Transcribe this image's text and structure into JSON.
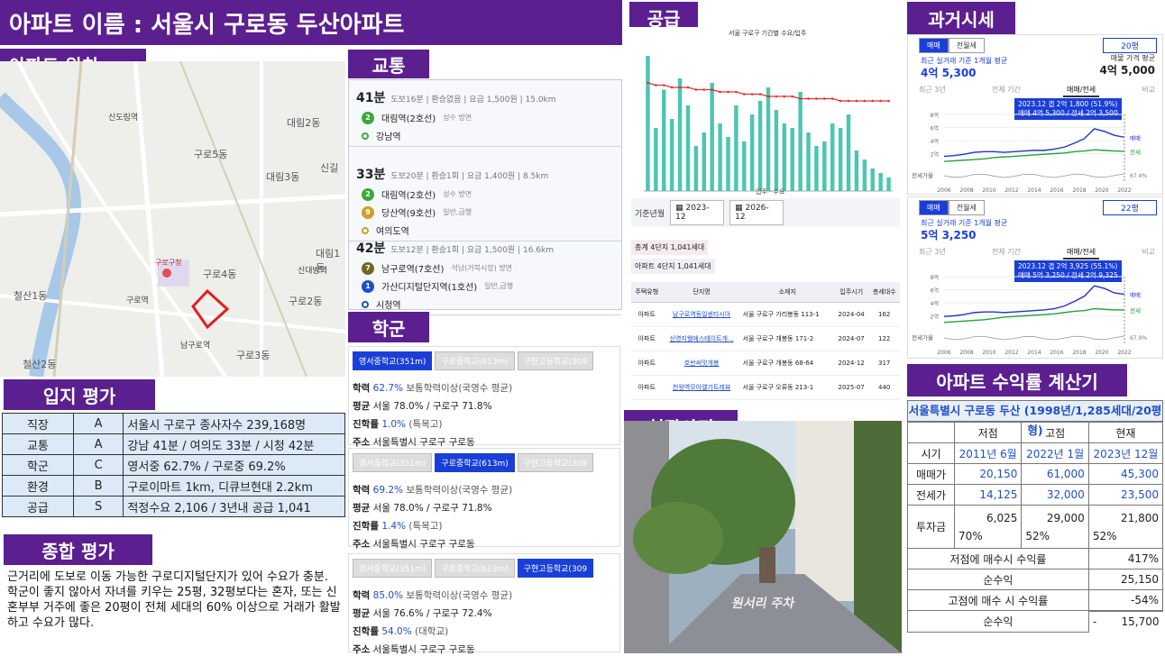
{
  "title": "아파트 이름 : 서울시 구로동 두산아파트",
  "sections": {
    "location": "아파트 위치",
    "traffic": "교통",
    "school": "학군",
    "supply": "공급",
    "history": "과거시세",
    "photo": "현장사진",
    "calc": "아파트 수익률 계산기",
    "eval": "입지 평가",
    "summary": "종합 평가"
  },
  "map": {
    "labels": [
      "신도림역",
      "구로5동",
      "대림3동",
      "구로2동",
      "구로4동",
      "구로3동",
      "철산1동",
      "철산2동",
      "구로역",
      "신대방역",
      "남구로역",
      "대림2동",
      "대림1동",
      "신길",
      "구로구청"
    ]
  },
  "eval": [
    {
      "k": "직장",
      "g": "A",
      "d": "서울시 구로구 종사자수 239,168명"
    },
    {
      "k": "교통",
      "g": "A",
      "d": "강남 41분 / 여의도 33분 / 시청 42분"
    },
    {
      "k": "학군",
      "g": "C",
      "d": "영서중 62.7% / 구로중 69.2%"
    },
    {
      "k": "환경",
      "g": "B",
      "d": "구로이마트 1km, 디큐브현대 2.2km"
    },
    {
      "k": "공급",
      "g": "S",
      "d": "적정수요 2,106 / 3년내 공급 1,041"
    }
  ],
  "summary_text": "근거리에 도보로 이동 가능한 구로디지털단지가 있어 수요가 충분. 학군이 좋지 않아서 자녀를 키우는 25평, 32평보다는 혼자, 또는 신혼부부 거주에 좋은 20평이 전체 세대의 60% 이상으로 거래가 활발하고 수요가 많다.",
  "traffic": [
    {
      "time": "41분",
      "info": "도보16분 | 환승없음 | 요금 1,500원 | 15.0km",
      "stops": [
        {
          "badge": "2",
          "color": "#3aa93a",
          "name": "대림역(2호선)",
          "dir": "성수 방면"
        },
        {
          "badge": "",
          "color": "#3aa93a",
          "name": "강남역",
          "dir": ""
        }
      ]
    },
    {
      "time": "33분",
      "info": "도보20분 | 환승1회 | 요금 1,400원 | 8.5km",
      "stops": [
        {
          "badge": "2",
          "color": "#3aa93a",
          "name": "대림역(2호선)",
          "dir": "성수 방면"
        },
        {
          "badge": "9",
          "color": "#c9a227",
          "name": "당산역(9호선)",
          "dir": "일반,급행"
        },
        {
          "badge": "",
          "color": "#c9a227",
          "name": "여의도역",
          "dir": ""
        }
      ]
    },
    {
      "time": "42분",
      "info": "도보12분 | 환승1회 | 요금 1,500원 | 16.6km",
      "stops": [
        {
          "badge": "7",
          "color": "#6b6b1f",
          "name": "남구로역(7호선)",
          "dir": "석남(거북시장) 방면"
        },
        {
          "badge": "1",
          "color": "#1f4fc8",
          "name": "가산디지털단지역(1호선)",
          "dir": "일반,급행"
        },
        {
          "badge": "",
          "color": "#1f4fc8",
          "name": "시청역",
          "dir": ""
        }
      ]
    }
  ],
  "schools": [
    {
      "tabs": [
        "영서중학교(351m)",
        "구로중학교(613m)",
        "구현고등학교(309"
      ],
      "active": 0,
      "score": "62.7%",
      "score_note": "보통학력이상(국영수 평균)",
      "avg": "서울 78.0% / 구로구 71.8%",
      "adv": "1.0%",
      "adv_note": "(특목고)",
      "addr": "서울특별시 구로구 구로동"
    },
    {
      "tabs": [
        "영서중학교(351m)",
        "구로중학교(613m)",
        "구현고등학교(309"
      ],
      "active": 1,
      "score": "69.2%",
      "score_note": "보통학력이상(국영수 평균)",
      "avg": "서울 78.0% / 구로구 71.8%",
      "adv": "1.4%",
      "adv_note": "(특목고)",
      "addr": "서울특별시 구로구 구로동"
    },
    {
      "tabs": [
        "영서중학교(351m)",
        "구로중학교(613m)",
        "구현고등학교(309"
      ],
      "active": 2,
      "score": "85.0%",
      "score_note": "보통학력이상(국영수 평균)",
      "avg": "서울 76.6% / 구로구 72.4%",
      "adv": "54.0%",
      "adv_note": "(대학교)",
      "addr": "서울특별시 구로구 구로동"
    }
  ],
  "school_labels": {
    "score": "학력",
    "avg": "평균",
    "adv": "진학률",
    "addr": "주소"
  },
  "supply": {
    "chart_title": "서울 구로구 기간별 수요/입주",
    "range_label": "기준년월",
    "from": "2023-12",
    "to": "2026-12",
    "legend": "입주 · 수요",
    "bars": [
      60,
      28,
      45,
      32,
      50,
      38,
      20,
      26,
      48,
      30,
      24,
      38,
      22,
      34,
      40,
      46,
      36,
      30,
      28,
      44,
      26,
      20,
      22,
      30,
      28,
      34,
      18,
      14,
      10,
      8,
      6
    ],
    "demand": [
      48,
      47,
      47,
      46,
      46,
      46,
      45,
      45,
      45,
      44,
      44,
      44,
      43,
      43,
      43,
      42,
      42,
      42,
      42,
      41,
      41,
      41,
      41,
      41,
      40,
      40,
      40,
      40,
      40,
      40,
      40
    ],
    "tags": [
      "총계 4단지 1,041세대",
      "아파트 4단지 1,041세대"
    ],
    "headers": [
      "주택유형",
      "단지명",
      "소재지",
      "입주시기",
      "총세대수"
    ],
    "rows": [
      [
        "아파트",
        "남구로역동일센타시아",
        "서울 구로구 가리봉동 113-1",
        "2024-04",
        "162"
      ],
      [
        "아파트",
        "신영지웰에스테이트개...",
        "서울 구로구 개봉동 171-2",
        "2024-07",
        "122"
      ],
      [
        "아파트",
        "호반써밋개봉",
        "서울 구로구 개봉동 68-64",
        "2024-12",
        "317"
      ],
      [
        "아파트",
        "천왕역모아엘가트레뷰",
        "서울 구로구 오류동 213-1",
        "2025-07",
        "440"
      ]
    ]
  },
  "history": [
    {
      "tabs": [
        "매매",
        "전월세"
      ],
      "sel": "20평",
      "caption": "최근 실거래 기준 1개월 평균",
      "left": "4억 5,300",
      "right_cap": "매물 가격 평균",
      "right": "4억 5,000",
      "periods": [
        "최근 3년",
        "전체 기간",
        "매매/전세",
        "비교"
      ],
      "tip1": "2023.12  갭 2억 1,800 (51.9%)",
      "tip2": "매매 4억 5,300 / 전세 2억 3,500",
      "years": [
        "2006",
        "2008",
        "2010",
        "2012",
        "2014",
        "2016",
        "2018",
        "2020",
        "2022"
      ],
      "yticks": [
        "8억",
        "6억",
        "4억",
        "2억"
      ],
      "series": [
        "매매",
        "전세"
      ],
      "gap_label": "전세가율",
      "gap_val": "67.4%",
      "sale": [
        1.6,
        1.7,
        1.9,
        2.2,
        2.3,
        2.3,
        2.2,
        2.3,
        2.4,
        2.5,
        2.5,
        2.7,
        3.0,
        3.6,
        4.3,
        5.8,
        5.4,
        4.8,
        4.5
      ],
      "jeonse": [
        0.8,
        0.9,
        1.0,
        1.1,
        1.2,
        1.4,
        1.5,
        1.6,
        1.7,
        1.8,
        1.9,
        2.0,
        2.1,
        2.3,
        2.4,
        2.6,
        2.5,
        2.4,
        2.35
      ]
    },
    {
      "tabs": [
        "매매",
        "전월세"
      ],
      "sel": "22평",
      "caption": "최근 실거래 기준 1개월 평균",
      "left": "5억 3,250",
      "right_cap": "",
      "right": "",
      "periods": [
        "최근 3년",
        "전체 기간",
        "매매/전세",
        "비교"
      ],
      "tip1": "2023.12  갭 2억 3,925 (55.1%)",
      "tip2": "매매 5억 3,250 / 전세 2억 9,325",
      "years": [
        "2006",
        "2008",
        "2010",
        "2012",
        "2014",
        "2016",
        "2018",
        "2020",
        "2022"
      ],
      "yticks": [
        "8억",
        "6억",
        "4억",
        "2억"
      ],
      "series": [
        "매매",
        "전세"
      ],
      "gap_label": "전세가율",
      "gap_val": "67.9%",
      "sale": [
        1.9,
        2.0,
        2.2,
        2.5,
        2.6,
        2.6,
        2.5,
        2.6,
        2.7,
        2.8,
        2.9,
        3.1,
        3.5,
        4.2,
        5.0,
        6.6,
        6.2,
        5.5,
        5.3
      ],
      "jeonse": [
        1.0,
        1.1,
        1.2,
        1.3,
        1.4,
        1.6,
        1.8,
        1.9,
        2.0,
        2.1,
        2.2,
        2.3,
        2.5,
        2.7,
        2.8,
        3.1,
        3.0,
        2.9,
        2.9
      ]
    }
  ],
  "calc": {
    "title": "서울특별시 구로동 두산 (1998년/1,285세대/20평형)",
    "cols": [
      "",
      "저점",
      "고점",
      "현재"
    ],
    "period": [
      "시기",
      "2011년 6월",
      "2022년 1월",
      "2023년 12월"
    ],
    "sale": [
      "매매가",
      "20,150",
      "61,000",
      "45,300"
    ],
    "jeonse": [
      "전세가",
      "14,125",
      "32,000",
      "23,500"
    ],
    "invest_label": "투자금",
    "invest": [
      "6,025",
      "29,000",
      "21,800"
    ],
    "invest_pct": [
      "70%",
      "52%",
      "52%"
    ],
    "r1": [
      "저점에 매수시 수익률",
      "417%"
    ],
    "r2": [
      "순수익",
      "25,150"
    ],
    "r3": [
      "고점에 매수 시 수익률",
      "-54%"
    ],
    "r4": [
      "순수익",
      "-",
      "15,700"
    ]
  },
  "photo_sign": "원서리 주차"
}
